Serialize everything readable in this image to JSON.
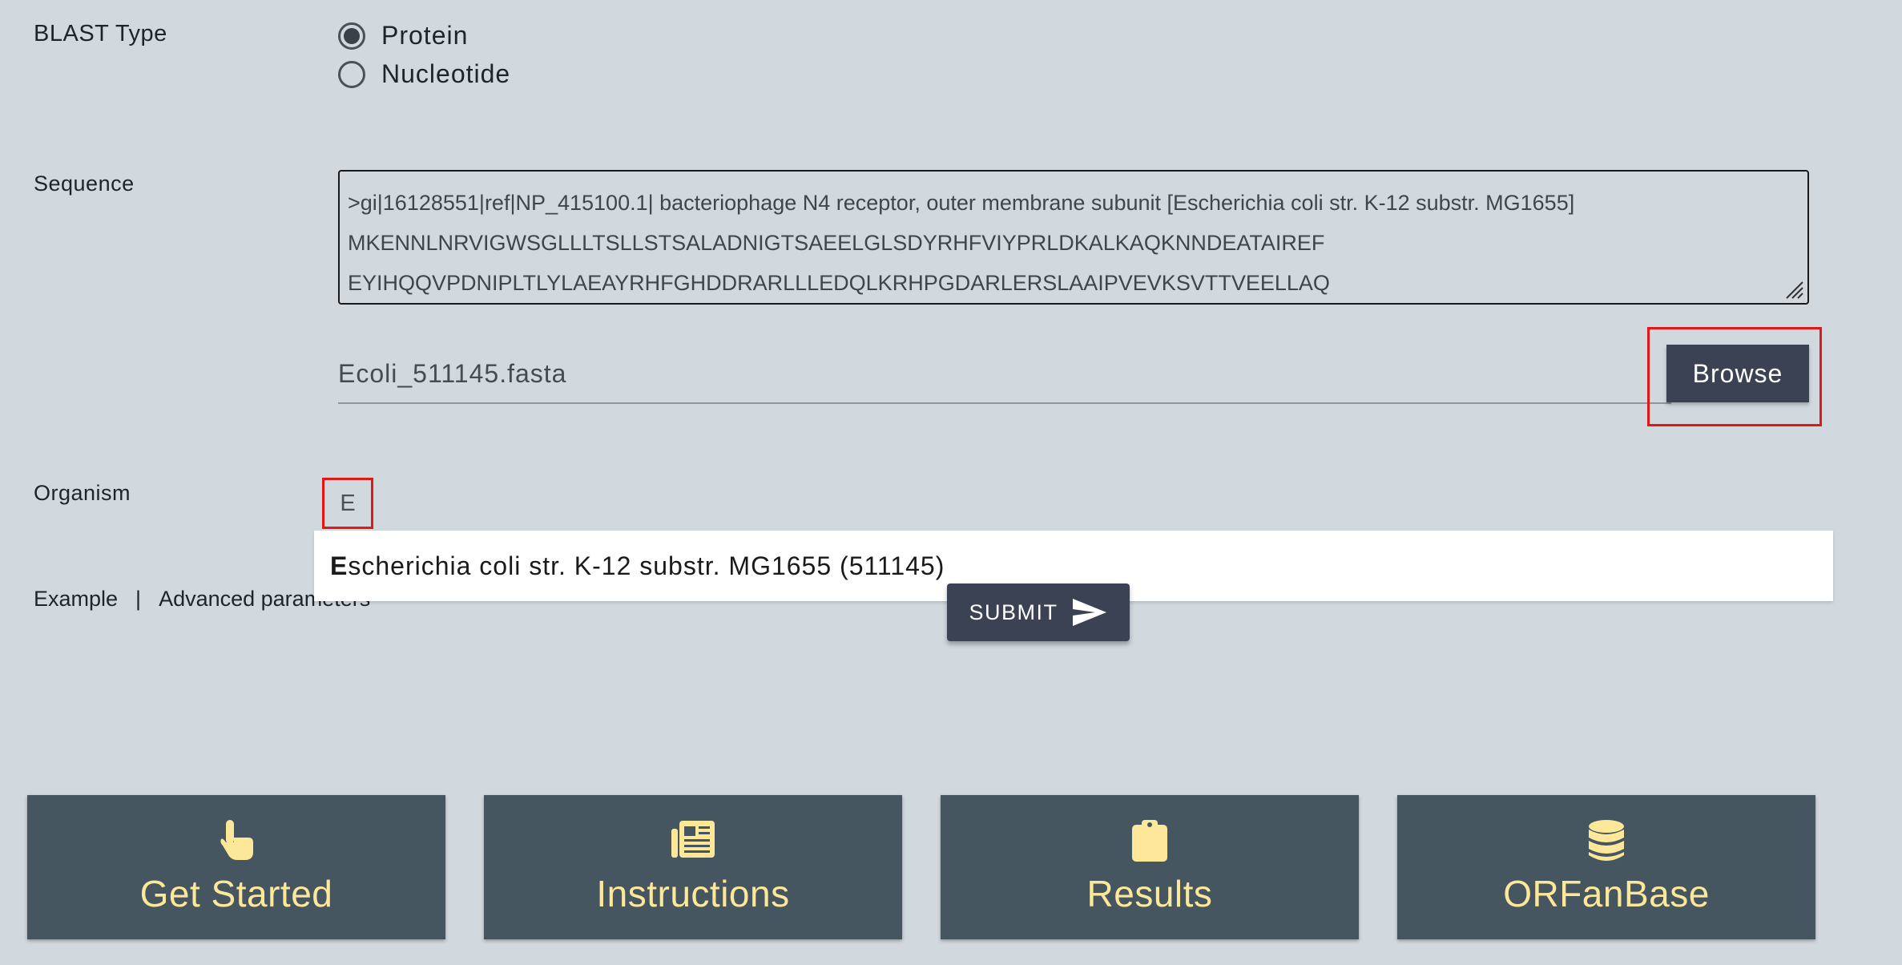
{
  "blast_type": {
    "label": "BLAST Type",
    "options": [
      {
        "label": "Protein",
        "selected": true
      },
      {
        "label": "Nucleotide",
        "selected": false
      }
    ]
  },
  "sequence": {
    "label": "Sequence",
    "lines": [
      ">gi|16128551|ref|NP_415100.1| bacteriophage N4 receptor, outer membrane subunit [Escherichia coli str. K-12 substr. MG1655]",
      "MKENNLNRVIGWSGLLLTSLLSTSALADNIGTSAEELGLSDYRHFVIYPRLDKALKAQKNNDEATAIREF",
      "EYIHQQVPDNIPLTLYLAEAYRHFGHDDRARLLLEDQLKRHPGDARLERSLAAIPVEVKSVTTVEELLAQ"
    ]
  },
  "file": {
    "filename": "Ecoli_511145.fasta",
    "browse_label": "Browse"
  },
  "organism": {
    "label": "Organism",
    "input_value": "E",
    "suggestion_match": "E",
    "suggestion_rest": "scherichia coli str. K-12 substr. MG1655 (511145)"
  },
  "links": {
    "example": "Example",
    "separator": "|",
    "advanced": "Advanced parameters"
  },
  "submit": {
    "label": "SUBMIT"
  },
  "cards": [
    {
      "title": "Get Started",
      "icon": "hand-pointer-icon"
    },
    {
      "title": "Instructions",
      "icon": "newspaper-icon"
    },
    {
      "title": "Results",
      "icon": "clipboard-icon"
    },
    {
      "title": "ORFanBase",
      "icon": "database-icon"
    }
  ],
  "colors": {
    "background": "#d1d9df",
    "button": "#3b4253",
    "card": "#455661",
    "card_text": "#fde89a",
    "highlight": "#e01818"
  }
}
